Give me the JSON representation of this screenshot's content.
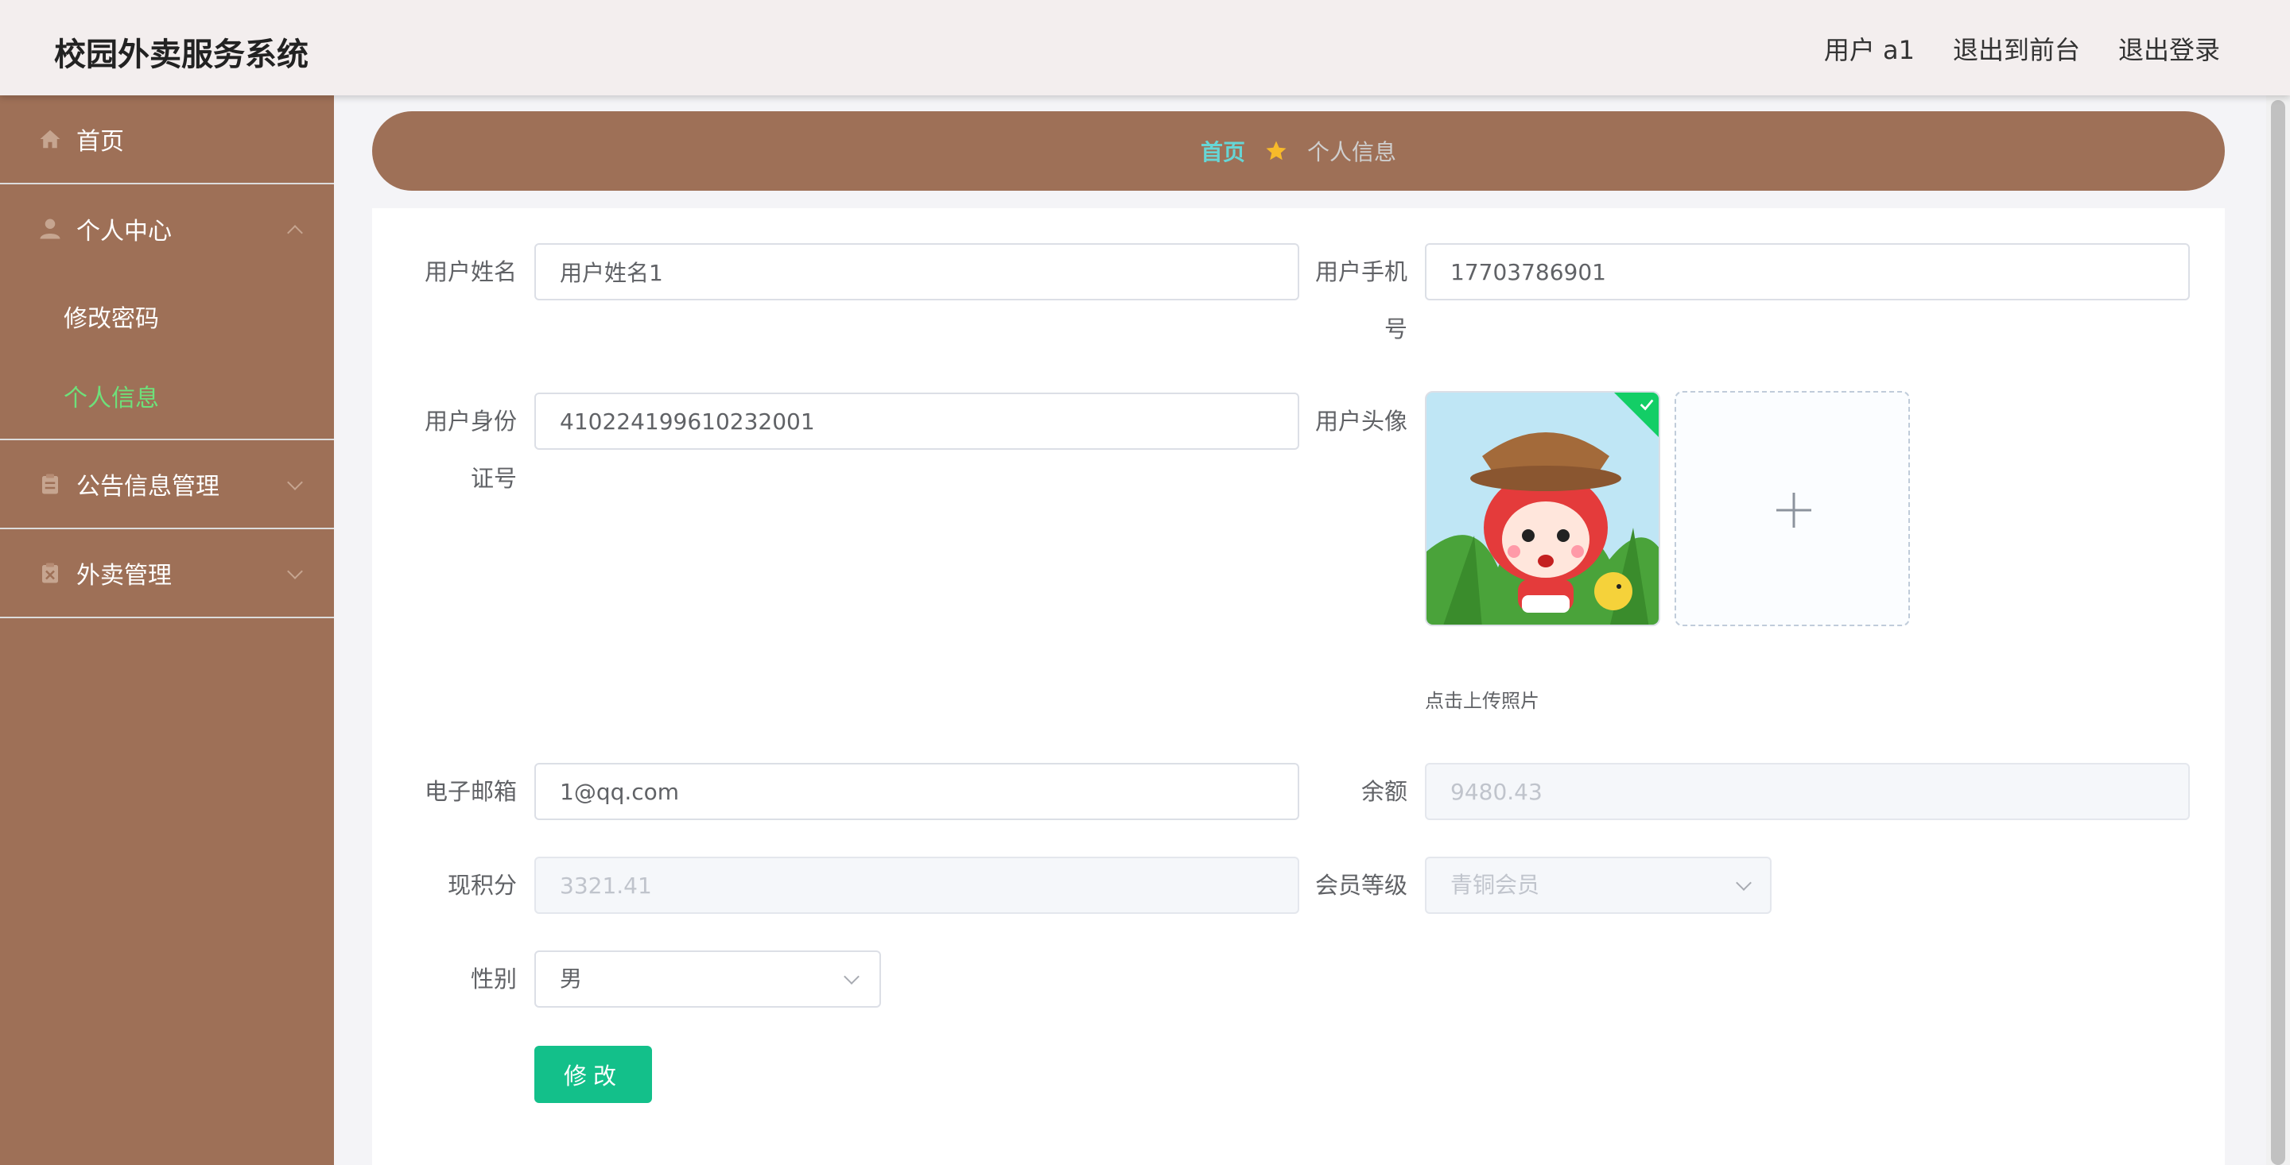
{
  "app": {
    "title": "校园外卖服务系统"
  },
  "header": {
    "user_label": "用户 a1",
    "to_front": "退出到前台",
    "logout": "退出登录"
  },
  "sidebar": {
    "home": "首页",
    "personal_center": {
      "label": "个人中心",
      "items": [
        "修改密码",
        "个人信息"
      ],
      "active": "个人信息"
    },
    "notice_mgmt": "公告信息管理",
    "takeout_mgmt": "外卖管理"
  },
  "breadcrumb": {
    "home": "首页",
    "current": "个人信息"
  },
  "form": {
    "name_label": "用户姓名",
    "name_value": "用户姓名1",
    "phone_label_1": "用户手机",
    "phone_label_2": "号",
    "phone_value": "17703786901",
    "idcard_label_1": "用户身份",
    "idcard_label_2": "证号",
    "idcard_value": "410224199610232001",
    "avatar_label": "用户头像",
    "upload_tip": "点击上传照片",
    "email_label": "电子邮箱",
    "email_value": "1@qq.com",
    "balance_label": "余额",
    "balance_value": "9480.43",
    "points_label": "现积分",
    "points_value": "3321.41",
    "member_label": "会员等级",
    "member_value": "青铜会员",
    "gender_label": "性别",
    "gender_value": "男",
    "submit_label": "修改"
  },
  "icons": {
    "home": "home-icon",
    "user": "user-icon",
    "notice": "clipboard-icon",
    "takeout": "clipboard-x-icon",
    "breadcrumb_sep": "star-icon",
    "upload": "plus-icon"
  },
  "colors": {
    "sidebar_bg": "#9e7057",
    "active_menu": "#6ee07a",
    "breadcrumb_home": "#66d6d6",
    "primary_button": "#13c08a",
    "star": "#f7ba2a"
  }
}
